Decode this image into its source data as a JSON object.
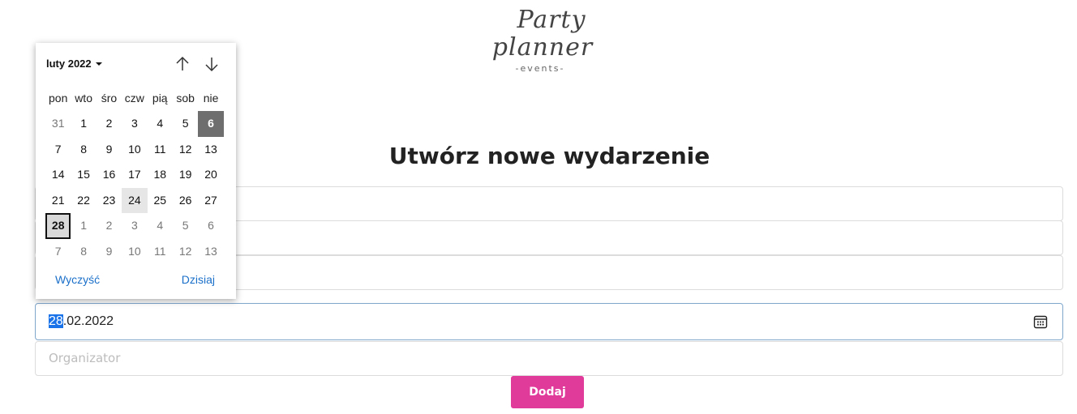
{
  "logo": {
    "line1": "Party",
    "line2": "planner",
    "line3": "-events-"
  },
  "page_title": "Utwórz nowe wydarzenie",
  "form": {
    "field1": {
      "value": "",
      "placeholder": ""
    },
    "field2": {
      "value": "",
      "placeholder": ""
    },
    "field3": {
      "value": "",
      "placeholder": ""
    },
    "date": {
      "day_selected": "28",
      "rest": ".02.2022"
    },
    "organizer": {
      "placeholder": "Organizator"
    },
    "submit_label": "Dodaj"
  },
  "calendar": {
    "month_label": "luty 2022",
    "weekdays": [
      "pon",
      "wto",
      "śro",
      "czw",
      "pią",
      "sob",
      "nie"
    ],
    "weeks": [
      [
        "31",
        "1",
        "2",
        "3",
        "4",
        "5",
        "6"
      ],
      [
        "7",
        "8",
        "9",
        "10",
        "11",
        "12",
        "13"
      ],
      [
        "14",
        "15",
        "16",
        "17",
        "18",
        "19",
        "20"
      ],
      [
        "21",
        "22",
        "23",
        "24",
        "25",
        "26",
        "27"
      ],
      [
        "28",
        "1",
        "2",
        "3",
        "4",
        "5",
        "6"
      ],
      [
        "7",
        "8",
        "9",
        "10",
        "11",
        "12",
        "13"
      ]
    ],
    "clear_label": "Wyczyść",
    "today_label": "Dzisiaj"
  }
}
